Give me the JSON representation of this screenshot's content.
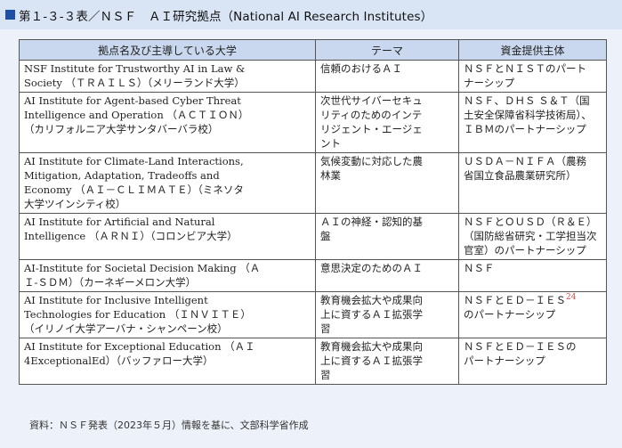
{
  "title": "第１-３-３表／ＮＳＦ　ＡＩ研究拠点（National AI Research Institutes）",
  "colors": {
    "title_bg": "#d9e4f5",
    "header_bg": "#c9d8ee",
    "accent": "#1f4fa3",
    "superscript": "#d24a4a"
  },
  "table": {
    "headers": [
      "拠点名及び主導している大学",
      "テーマ",
      "資金提供主体"
    ],
    "rows": [
      {
        "institute": [
          "NSF Institute for Trustworthy AI in Law &",
          "Society （ＴＲＡＩＬＳ）（メリーランド大学）"
        ],
        "theme": [
          "信頼のおけるＡＩ"
        ],
        "funder": [
          "ＮＳＦとＮＩＳＴのパート",
          "ナーシップ"
        ]
      },
      {
        "institute": [
          "AI Institute for Agent-based Cyber Threat",
          "Intelligence and Operation （ＡＣＴＩＯＮ）",
          "（カリフォルニア大学サンタバーバラ校）"
        ],
        "theme": [
          "次世代サイバーセキュ",
          "リティのためのインテ",
          "リジェント・エージェ",
          "ント"
        ],
        "funder": [
          "ＮＳＦ、ＤＨＳ Ｓ＆Ｔ（国",
          "土安全保障省科学技術局）、",
          "ＩＢＭのパートナーシップ"
        ]
      },
      {
        "institute": [
          "AI Institute for Climate-Land Interactions,",
          "Mitigation, Adaptation, Tradeoffs and",
          "Economy （ＡＩ－ＣＬＩＭＡＴＥ）（ミネソタ",
          "大学ツインシティ校）"
        ],
        "theme": [
          "気候変動に対応した農",
          "林業"
        ],
        "funder": [
          "ＵＳＤＡ－ＮＩＦＡ（農務",
          "省国立食品農業研究所）"
        ]
      },
      {
        "institute": [
          "AI Institute for Artificial and Natural",
          "Intelligence （ＡＲＮＩ）（コロンビア大学）"
        ],
        "theme": [
          "ＡＩの神経・認知的基",
          "盤"
        ],
        "funder": [
          "ＮＳＦとＯＵＳＤ（Ｒ＆Ｅ）",
          "（国防総省研究・工学担当次",
          "官室）のパートナーシップ"
        ]
      },
      {
        "institute": [
          "AI-Institute for Societal Decision Making （Ａ",
          "Ｉ-ＳＤＭ）（カーネギーメロン大学）"
        ],
        "theme": [
          "意思決定のためのＡＩ"
        ],
        "funder": [
          "ＮＳＦ"
        ]
      },
      {
        "institute": [
          "AI Institute for Inclusive Intelligent",
          "Technologies for Education （ＩＮＶＩＴＥ）",
          "（イリノイ大学アーバナ・シャンペーン校）"
        ],
        "theme": [
          "教育機会拡大や成果向",
          "上に資するＡＩ拡張学",
          "習"
        ],
        "funder": [
          "ＮＳＦとＥＤ－ＩＥＳ",
          "のパートナーシップ"
        ],
        "funder_note": "24"
      },
      {
        "institute": [
          "AI Institute for Exceptional Education （ＡＩ",
          "4ExceptionalEd）（バッファロー大学）"
        ],
        "theme": [
          "教育機会拡大や成果向",
          "上に資するＡＩ拡張学",
          "習"
        ],
        "funder": [
          "ＮＳＦとＥＤ－ＩＥＳの",
          "パートナーシップ"
        ]
      }
    ]
  },
  "source": "資料：ＮＳＦ発表（2023年５月）情報を基に、文部科学省作成"
}
